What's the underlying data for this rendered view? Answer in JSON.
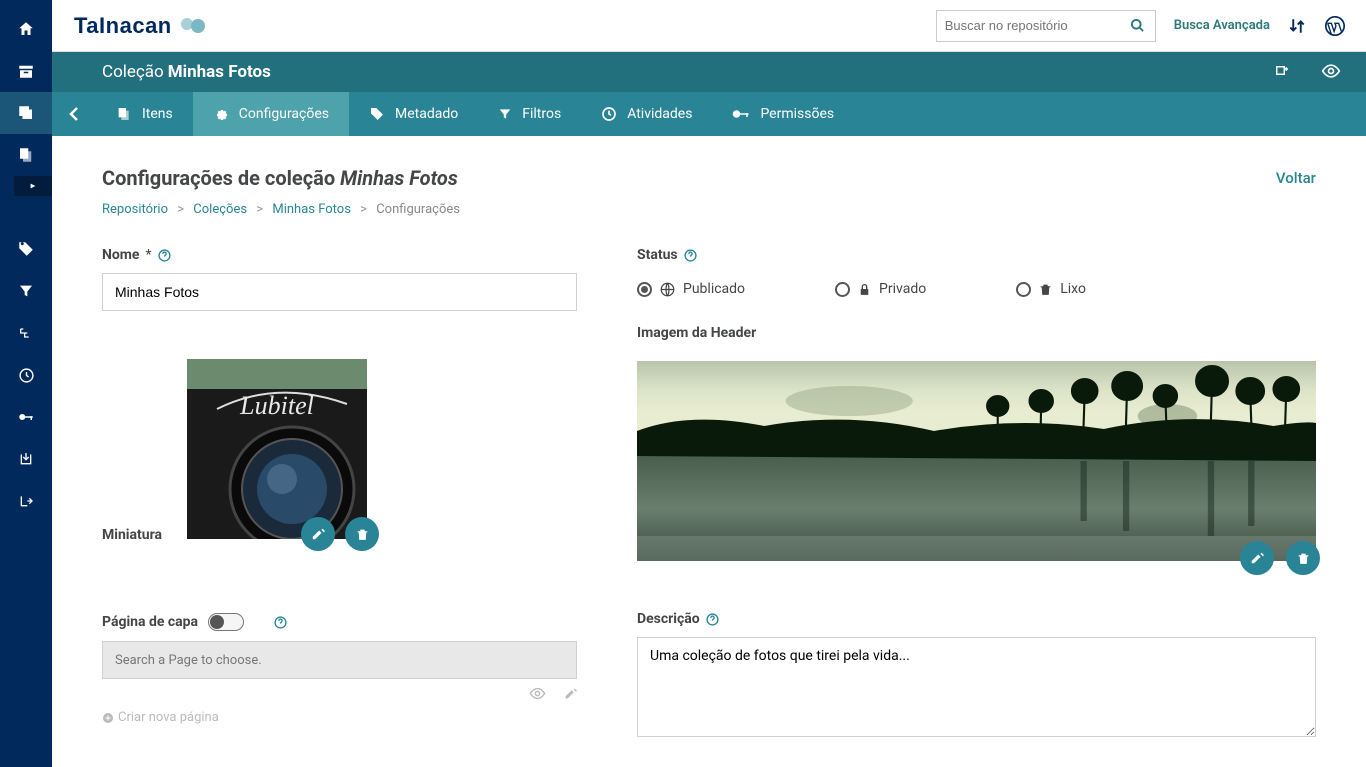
{
  "brand": "TaInacan",
  "search": {
    "placeholder": "Buscar no repositório"
  },
  "adv_search": "Busca Avançada",
  "coll_header": {
    "prefix": "Coleção",
    "name": "Minhas Fotos"
  },
  "tabs": {
    "itens": "Itens",
    "config": "Configurações",
    "metadado": "Metadado",
    "filtros": "Filtros",
    "atividades": "Atividades",
    "permissoes": "Permissões"
  },
  "page": {
    "title_prefix": "Configurações de coleção ",
    "title_name": "Minhas Fotos",
    "voltar": "Voltar"
  },
  "breadcrumb": {
    "repo": "Repositório",
    "colecoes": "Coleções",
    "coll": "Minhas Fotos",
    "current": "Configurações"
  },
  "form": {
    "nome_label": "Nome",
    "nome_value": "Minhas Fotos",
    "miniatura_label": "Miniatura",
    "status_label": "Status",
    "status_publicado": "Publicado",
    "status_privado": "Privado",
    "status_lixo": "Lixo",
    "header_img_label": "Imagem da Header",
    "descricao_label": "Descrição",
    "descricao_value": "Uma coleção de fotos que tirei pela vida...",
    "capa_label": "Página de capa",
    "capa_placeholder": "Search a Page to choose.",
    "criar_pagina": "Criar nova página"
  }
}
